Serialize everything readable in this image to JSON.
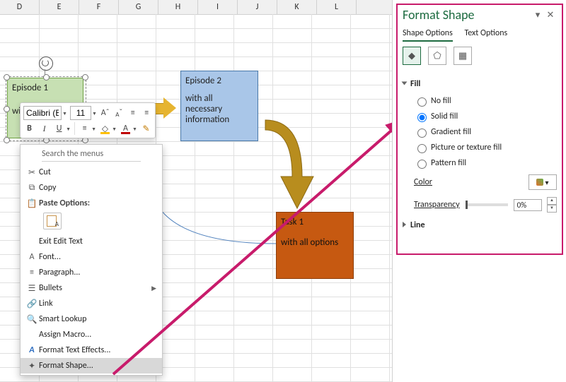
{
  "columns": [
    "D",
    "E",
    "F",
    "G",
    "H",
    "I",
    "J",
    "K",
    "L"
  ],
  "shapes": {
    "episode1": {
      "title": "Episode 1",
      "body": "wi"
    },
    "episode2": {
      "title": "Episode 2",
      "body1": "with all",
      "body2": "necessary",
      "body3": "information"
    },
    "task1": {
      "title": "Task 1",
      "body": "with all options"
    }
  },
  "minitoolbar": {
    "font_name": "Calibri (B",
    "font_size": "11"
  },
  "contextmenu": {
    "search_placeholder": "Search the menus",
    "cut": "Cut",
    "copy": "Copy",
    "paste_options": "Paste Options:",
    "exit_edit_text": "Exit Edit Text",
    "font": "Font...",
    "paragraph": "Paragraph...",
    "bullets": "Bullets",
    "link": "Link",
    "smart_lookup": "Smart Lookup",
    "assign_macro": "Assign Macro...",
    "format_text_effects": "Format Text Effects...",
    "format_shape": "Format Shape..."
  },
  "panel": {
    "title": "Format Shape",
    "tab_shape": "Shape Options",
    "tab_text": "Text Options",
    "section_fill": "Fill",
    "section_line": "Line",
    "fill": {
      "no_fill": "No fill",
      "solid_fill": "Solid fill",
      "gradient_fill": "Gradient fill",
      "picture_fill": "Picture or texture fill",
      "pattern_fill": "Pattern fill"
    },
    "color_label": "Color",
    "transparency_label": "Transparency",
    "transparency_value": "0%"
  }
}
